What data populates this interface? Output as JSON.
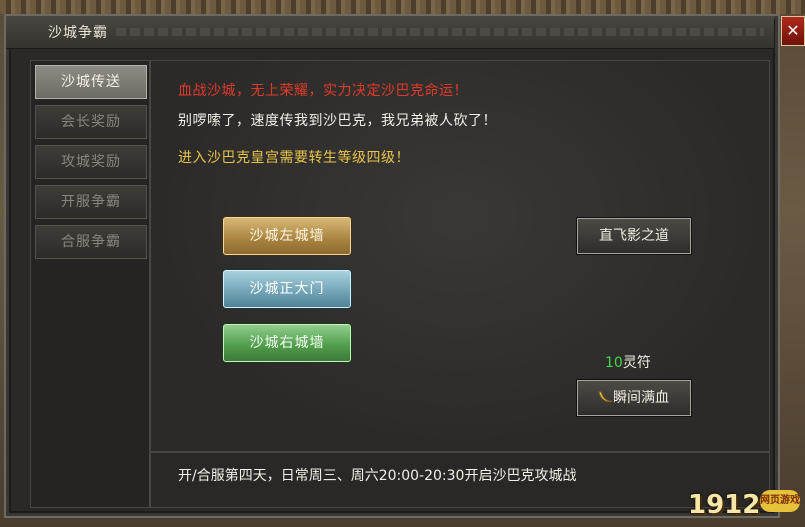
{
  "window": {
    "title": "沙城争霸",
    "close_label": "✕"
  },
  "tabs": [
    {
      "label": "沙城传送",
      "active": true
    },
    {
      "label": "会长奖励",
      "active": false
    },
    {
      "label": "攻城奖励",
      "active": false
    },
    {
      "label": "开服争霸",
      "active": false
    },
    {
      "label": "合服争霸",
      "active": false
    }
  ],
  "content": {
    "line1": "血战沙城，无上荣耀，实力决定沙巴克命运！",
    "line2": "别啰嗦了，速度传我到沙巴克，我兄弟被人砍了！",
    "line3": "进入沙巴克皇宫需要转生等级四级！"
  },
  "teleport": {
    "left_wall": "沙城左城墙",
    "main_gate": "沙城正大门",
    "right_wall": "沙城右城墙"
  },
  "actions": {
    "fly_label": "直飞影之道",
    "charm_count": "10",
    "charm_unit": "灵符",
    "heal_label": "瞬间满血"
  },
  "footer": {
    "text": "开/合服第四天，日常周三、周六20:00-20:30开启沙巴克攻城战"
  },
  "watermark": {
    "logo": "1912",
    "badge": "网页游戏"
  },
  "colors": {
    "warning_red": "#e23a2a",
    "notice_yellow": "#e8c44a",
    "charm_green": "#3fd84a"
  }
}
